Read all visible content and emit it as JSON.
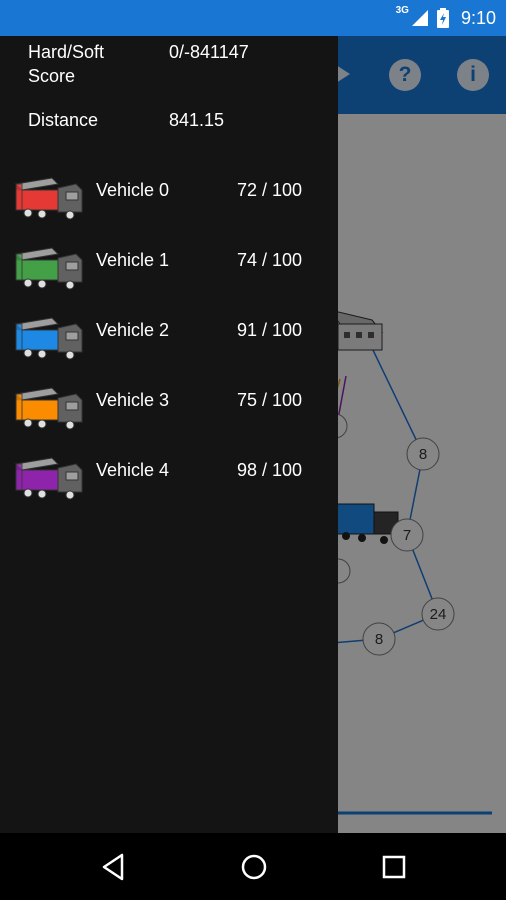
{
  "status_bar": {
    "network": "3G",
    "time": "9:10",
    "icons": [
      "signal-icon",
      "battery-icon"
    ]
  },
  "toolbar": {
    "icons": [
      "play-icon",
      "help-icon",
      "info-icon"
    ]
  },
  "map": {
    "node_labels": [
      "8",
      "7",
      "24",
      "8"
    ]
  },
  "drawer": {
    "score_label": "Hard/Soft Score",
    "score_value": "0/-841147",
    "distance_label": "Distance",
    "distance_value": "841.15",
    "vehicles": [
      {
        "name": "Vehicle 0",
        "load": "72 / 100",
        "color": "#e53935"
      },
      {
        "name": "Vehicle 1",
        "load": "74 / 100",
        "color": "#43a047"
      },
      {
        "name": "Vehicle 2",
        "load": "91 / 100",
        "color": "#1e88e5"
      },
      {
        "name": "Vehicle 3",
        "load": "75 / 100",
        "color": "#fb8c00"
      },
      {
        "name": "Vehicle 4",
        "load": "98 / 100",
        "color": "#8e24aa"
      }
    ]
  },
  "nav_bar": {
    "buttons": [
      "back-icon",
      "home-icon",
      "recents-icon"
    ]
  },
  "colors": {
    "primary": "#1976d2",
    "drawer_bg": "#141414"
  }
}
